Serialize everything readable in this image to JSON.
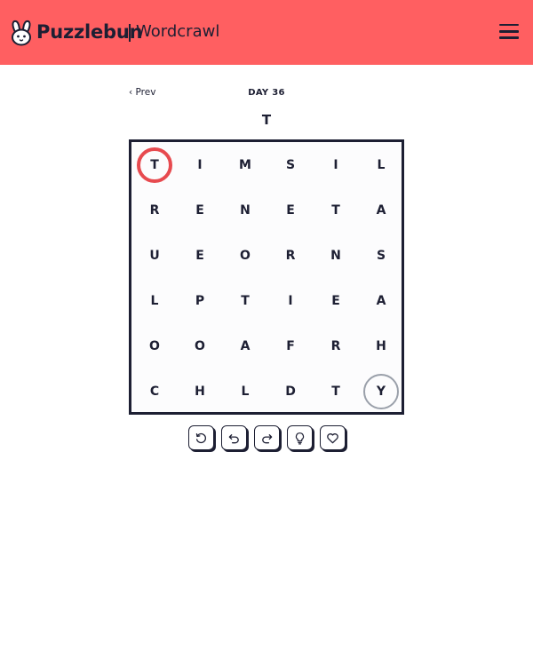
{
  "header": {
    "brand": "Puzzlebun",
    "game": "Wordcrawl",
    "logo_icon": "bunny-logo-icon",
    "menu_icon": "hamburger-menu-icon",
    "background_color": "#ff5f61"
  },
  "nav": {
    "prev_label": "‹ Prev",
    "day_label": "DAY 36"
  },
  "current_word": "T",
  "grid": {
    "rows": [
      [
        "T",
        "I",
        "M",
        "S",
        "I",
        "L"
      ],
      [
        "R",
        "E",
        "N",
        "E",
        "T",
        "A"
      ],
      [
        "U",
        "E",
        "O",
        "R",
        "N",
        "S"
      ],
      [
        "L",
        "P",
        "T",
        "I",
        "E",
        "A"
      ],
      [
        "O",
        "O",
        "A",
        "F",
        "R",
        "H"
      ],
      [
        "C",
        "H",
        "L",
        "D",
        "T",
        "Y"
      ]
    ],
    "start_cell": {
      "row": 0,
      "col": 0,
      "color": "#e74a4f"
    },
    "end_cell": {
      "row": 5,
      "col": 5,
      "color": "#9aa0aa"
    }
  },
  "toolbar": {
    "buttons": [
      {
        "name": "reset-button",
        "icon": "reset-icon"
      },
      {
        "name": "undo-button",
        "icon": "undo-icon"
      },
      {
        "name": "redo-button",
        "icon": "redo-icon"
      },
      {
        "name": "hint-button",
        "icon": "lightbulb-icon"
      },
      {
        "name": "favorite-button",
        "icon": "heart-icon"
      }
    ]
  }
}
